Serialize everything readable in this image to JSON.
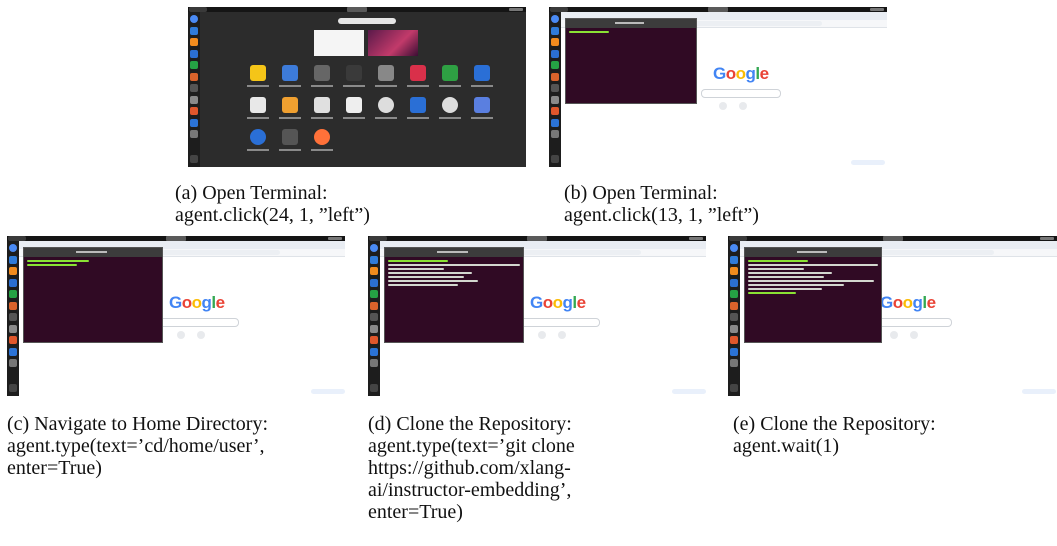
{
  "panels": {
    "a": {
      "caption_line1": "(a) Open Terminal:",
      "caption_line2": "agent.click(24, 1, ”left”)"
    },
    "b": {
      "caption_line1": "(b) Open Terminal:",
      "caption_line2": "agent.click(13, 1, ”left”)"
    },
    "c": {
      "caption_line1": "(c) Navigate to Home Directory:",
      "caption_line2": "agent.type(text=’cd/home/user’,",
      "caption_line3": "enter=True)"
    },
    "d": {
      "caption_line1": "(d) Clone the Repository:",
      "caption_line2": "agent.type(text=’git clone",
      "caption_line3": "https://github.com/xlang-",
      "caption_line4": "ai/instructor-embedding’,",
      "caption_line5": "enter=True)"
    },
    "e": {
      "caption_line1": "(e) Clone the Repository:",
      "caption_line2": "agent.wait(1)"
    }
  },
  "google_logo": [
    "G",
    "o",
    "o",
    "g",
    "l",
    "e"
  ],
  "google_colors": [
    "#4285f4",
    "#ea4335",
    "#fbbc05",
    "#4285f4",
    "#34a853",
    "#ea4335"
  ],
  "dock_icons": [
    "chrome-icon",
    "vscode-icon",
    "vlc-icon",
    "libreoffice-writer-icon",
    "libreoffice-calc-icon",
    "libreoffice-impress-icon",
    "terminal-icon",
    "files-icon",
    "software-icon",
    "help-icon",
    "trash-icon",
    "show-apps-icon"
  ],
  "dock_colors": [
    "#4a8af4",
    "#2f7bd9",
    "#f28c1e",
    "#2b6fd1",
    "#25a244",
    "#d9632b",
    "#555555",
    "#8a8a8a",
    "#e0572c",
    "#2b73d6",
    "#777777",
    "#444444"
  ],
  "terminal_bg": "#300a24"
}
